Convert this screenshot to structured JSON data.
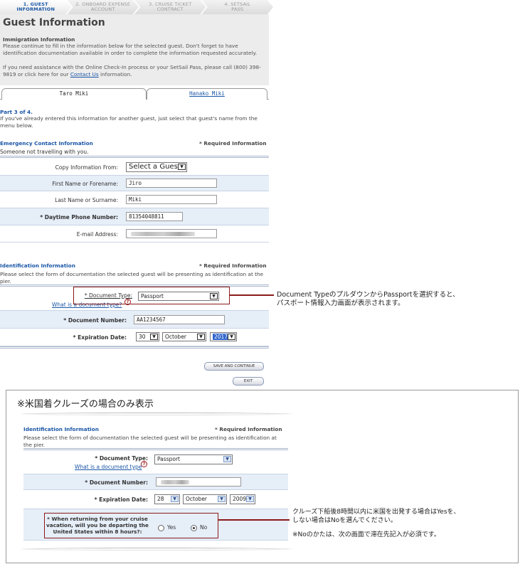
{
  "steps": [
    {
      "num": "1. GUEST",
      "label": "INFORMATION"
    },
    {
      "num": "2. ONBOARD EXPENSE",
      "label": "ACCOUNT"
    },
    {
      "num": "3. CRUISE TICKET",
      "label": "CONTRACT"
    },
    {
      "num": "4. SETSAIL",
      "label": "PASS"
    }
  ],
  "page": {
    "title": "Guest Information",
    "intro_heading": "Immigration Information",
    "intro_text": "Please continue to fill in the information below for the selected guest. Don't forget to have identification documentation available in order to complete the information requested accurately.",
    "assist_text": "If you need assistance with the Online Check-In process or your SetSail Pass, please call (800) 398-9819 or click here for our",
    "contact_link": "Contact Us",
    "assist_suffix": "information."
  },
  "tabs": [
    {
      "label": "Taro Miki"
    },
    {
      "label": "Hanako Miki"
    }
  ],
  "part": {
    "title": "Part 3 of 4.",
    "text": "If you've already entered this information for another guest, just select that guest's name from the menu below."
  },
  "emergency": {
    "heading": "Emergency Contact Information",
    "required": "* Required Information",
    "sub": "Someone not travelling with you.",
    "copy_label": "Copy Information From:",
    "copy_value": "Select a Guest",
    "first_label": "First Name or Forename:",
    "first_value": "Jiro",
    "last_label": "Last Name or Surname:",
    "last_value": "Miki",
    "phone_label": "* Daytime Phone Number:",
    "phone_value": "81354048811",
    "email_label": "E-mail Address:"
  },
  "identification": {
    "heading": "Identification Information",
    "required": "* Required Information",
    "text": "Please select the form of documentation the selected guest will be presenting as identification at the pier.",
    "doctype_label": "* Document Type:",
    "doctype_value": "Passport",
    "whatis_link": "What is a document type?",
    "docnum_label": "* Document Number:",
    "docnum_value": "AA1234567",
    "exp_label": "* Expiration Date:",
    "exp_day": "30",
    "exp_month": "October",
    "exp_year": "2017"
  },
  "buttons": {
    "save": "SAVE AND CONTINUE",
    "exit": "EXIT"
  },
  "callout1": {
    "line1": "Document Typeのプルダウンからを選択すると、",
    "line1a": "Document Typeのプルダウンから",
    "line1b": "Passport",
    "line1c": "を選択すると、",
    "line2": "パスポート情報入力画面が表示されます。"
  },
  "panel": {
    "title": "※米国着クルーズの場合のみ表示",
    "heading": "Identification Information",
    "required": "* Required Information",
    "text": "Please select the form of documentation the selected guest will be presenting as identification at the pier.",
    "doctype_label": "* Document Type:",
    "doctype_value": "Passport",
    "whatis_link": "What is a document type",
    "docnum_label": "* Document Number:",
    "exp_label": "* Expiration Date:",
    "exp_day": "28",
    "exp_month": "October",
    "exp_year": "2009",
    "question": "* When returning from your cruise vacation, will you be departing the United States within 8 hours?:",
    "yes": "Yes",
    "no": "No",
    "selected": "No"
  },
  "callout2": {
    "line1": "クルーズ下船後8時間以内に米国を出発する場合はYesを、",
    "line2": "しない場合はNoを選んでください。",
    "line3": "※Noのかたは、次の画面で滞在先記入が必須です。"
  }
}
